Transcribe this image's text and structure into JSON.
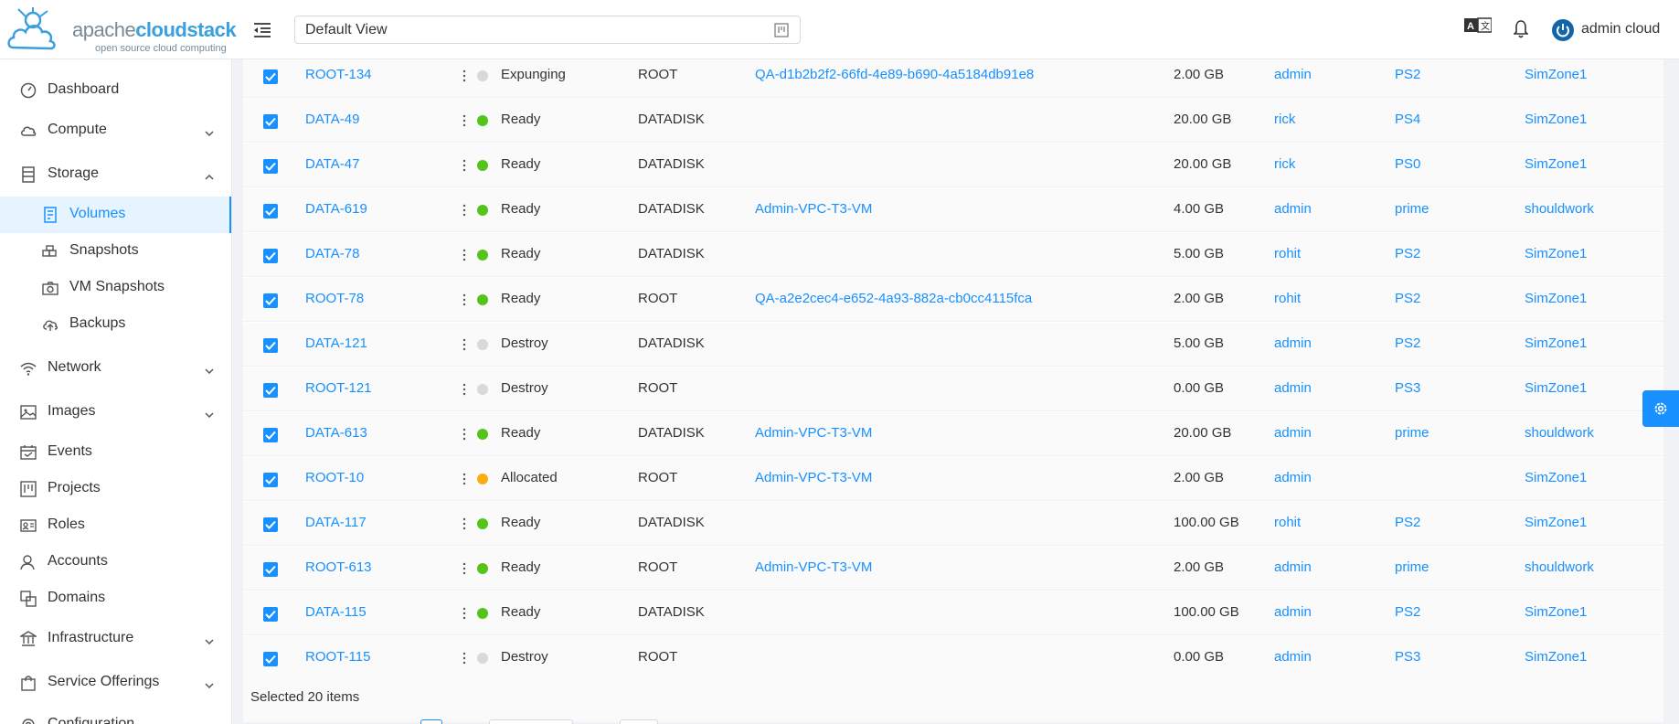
{
  "logo": {
    "brand_light": "apache",
    "brand_bold": "cloudstack",
    "tagline": "open source cloud computing"
  },
  "header": {
    "view_label": "Default View",
    "user_name": "admin cloud"
  },
  "sidebar": {
    "items": [
      {
        "label": "Dashboard",
        "icon": "dashboard-icon"
      },
      {
        "label": "Compute",
        "icon": "cloud-icon"
      },
      {
        "label": "Storage",
        "icon": "database-icon"
      },
      {
        "label": "Volumes",
        "icon": "hdd-icon"
      },
      {
        "label": "Snapshots",
        "icon": "build-icon"
      },
      {
        "label": "VM Snapshots",
        "icon": "camera-icon"
      },
      {
        "label": "Backups",
        "icon": "cloud-upload-icon"
      },
      {
        "label": "Network",
        "icon": "wifi-icon"
      },
      {
        "label": "Images",
        "icon": "picture-icon"
      },
      {
        "label": "Events",
        "icon": "schedule-icon"
      },
      {
        "label": "Projects",
        "icon": "project-icon"
      },
      {
        "label": "Roles",
        "icon": "idcard-icon"
      },
      {
        "label": "Accounts",
        "icon": "team-icon"
      },
      {
        "label": "Domains",
        "icon": "block-icon"
      },
      {
        "label": "Infrastructure",
        "icon": "bank-icon"
      },
      {
        "label": "Service Offerings",
        "icon": "shopping-icon"
      },
      {
        "label": "Configuration",
        "icon": "setting-icon"
      }
    ]
  },
  "table": {
    "rows": [
      {
        "name": "ROOT-134",
        "state": "Expunging",
        "type": "ROOT",
        "vm": "QA-d1b2b2f2-66fd-4e89-b690-4a5184db91e8",
        "size": "2.00 GB",
        "account": "admin",
        "storage": "PS2",
        "zone": "SimZone1"
      },
      {
        "name": "DATA-49",
        "state": "Ready",
        "type": "DATADISK",
        "vm": "",
        "size": "20.00 GB",
        "account": "rick",
        "storage": "PS4",
        "zone": "SimZone1"
      },
      {
        "name": "DATA-47",
        "state": "Ready",
        "type": "DATADISK",
        "vm": "",
        "size": "20.00 GB",
        "account": "rick",
        "storage": "PS0",
        "zone": "SimZone1"
      },
      {
        "name": "DATA-619",
        "state": "Ready",
        "type": "DATADISK",
        "vm": "Admin-VPC-T3-VM",
        "size": "4.00 GB",
        "account": "admin",
        "storage": "prime",
        "zone": "shouldwork"
      },
      {
        "name": "DATA-78",
        "state": "Ready",
        "type": "DATADISK",
        "vm": "",
        "size": "5.00 GB",
        "account": "rohit",
        "storage": "PS2",
        "zone": "SimZone1"
      },
      {
        "name": "ROOT-78",
        "state": "Ready",
        "type": "ROOT",
        "vm": "QA-a2e2cec4-e652-4a93-882a-cb0cc4115fca",
        "size": "2.00 GB",
        "account": "rohit",
        "storage": "PS2",
        "zone": "SimZone1"
      },
      {
        "name": "DATA-121",
        "state": "Destroy",
        "type": "DATADISK",
        "vm": "",
        "size": "5.00 GB",
        "account": "admin",
        "storage": "PS2",
        "zone": "SimZone1"
      },
      {
        "name": "ROOT-121",
        "state": "Destroy",
        "type": "ROOT",
        "vm": "",
        "size": "0.00 GB",
        "account": "admin",
        "storage": "PS3",
        "zone": "SimZone1"
      },
      {
        "name": "DATA-613",
        "state": "Ready",
        "type": "DATADISK",
        "vm": "Admin-VPC-T3-VM",
        "size": "20.00 GB",
        "account": "admin",
        "storage": "prime",
        "zone": "shouldwork"
      },
      {
        "name": "ROOT-10",
        "state": "Allocated",
        "type": "ROOT",
        "vm": "Admin-VPC-T3-VM",
        "size": "2.00 GB",
        "account": "admin",
        "storage": "",
        "zone": "SimZone1"
      },
      {
        "name": "DATA-117",
        "state": "Ready",
        "type": "DATADISK",
        "vm": "",
        "size": "100.00 GB",
        "account": "rohit",
        "storage": "PS2",
        "zone": "SimZone1"
      },
      {
        "name": "ROOT-613",
        "state": "Ready",
        "type": "ROOT",
        "vm": "Admin-VPC-T3-VM",
        "size": "2.00 GB",
        "account": "admin",
        "storage": "prime",
        "zone": "shouldwork"
      },
      {
        "name": "DATA-115",
        "state": "Ready",
        "type": "DATADISK",
        "vm": "",
        "size": "100.00 GB",
        "account": "admin",
        "storage": "PS2",
        "zone": "SimZone1"
      },
      {
        "name": "ROOT-115",
        "state": "Destroy",
        "type": "ROOT",
        "vm": "",
        "size": "0.00 GB",
        "account": "admin",
        "storage": "PS3",
        "zone": "SimZone1"
      }
    ],
    "selected_text": "Selected 20 items"
  },
  "colors": {
    "accent": "#1890ff",
    "ready": "#52c41a",
    "allocated": "#faad14",
    "inactive": "#d9d9d9"
  }
}
